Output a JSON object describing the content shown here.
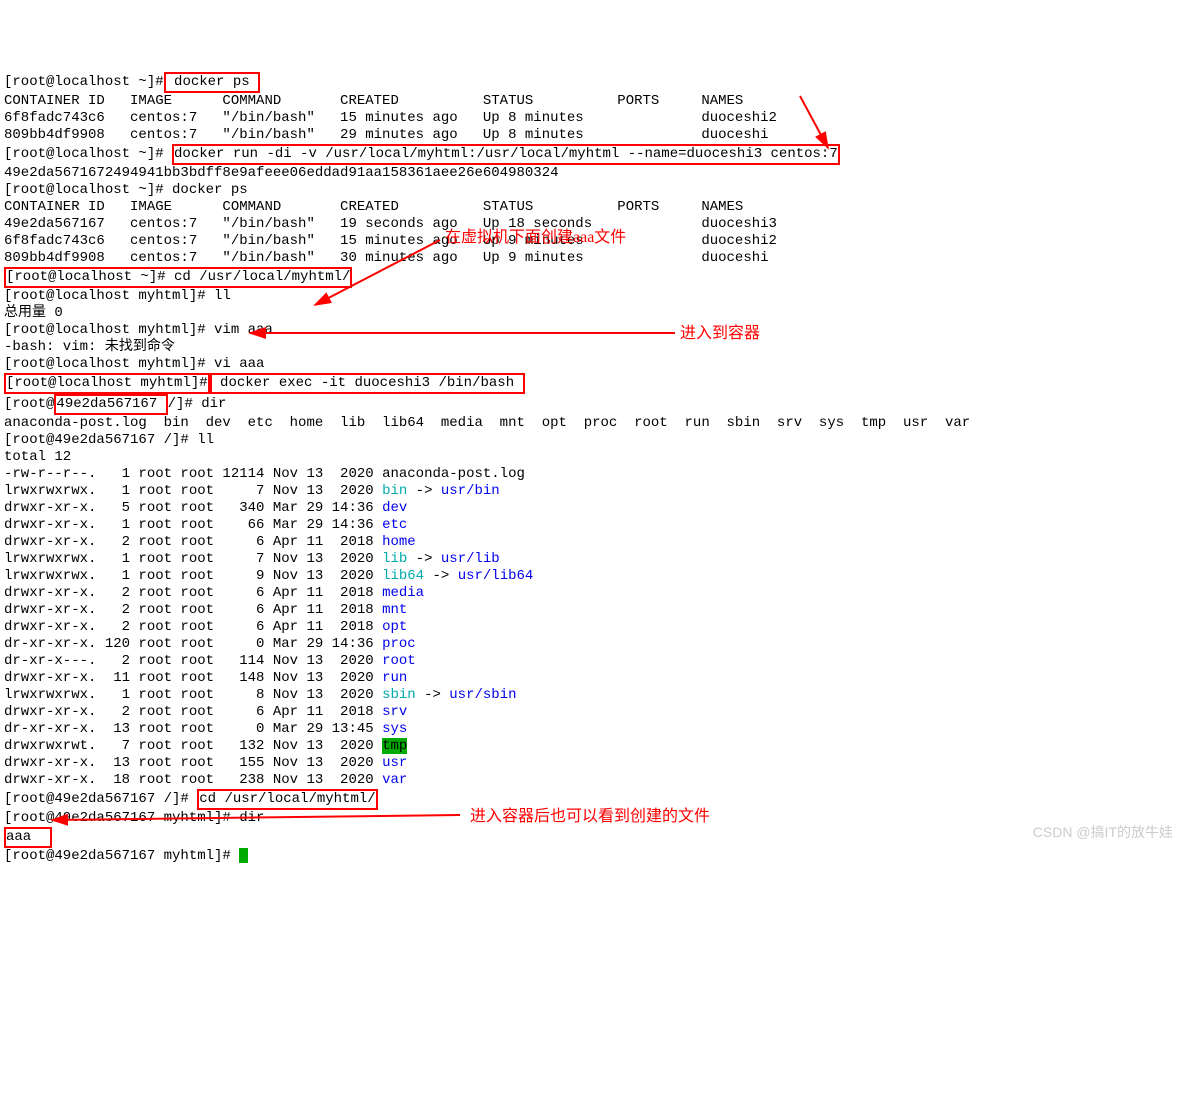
{
  "line1_prompt": "[root@localhost ~]#",
  "line1_cmd": " docker ps ",
  "docker_ps_header": "CONTAINER ID   IMAGE      COMMAND       CREATED          STATUS          PORTS     NAMES",
  "ps1_rows": [
    "6f8fadc743c6   centos:7   \"/bin/bash\"   15 minutes ago   Up 8 minutes              duoceshi2",
    "809bb4df9908   centos:7   \"/bin/bash\"   29 minutes ago   Up 8 minutes              duoceshi"
  ],
  "line_run_prompt": "[root@localhost ~]# ",
  "line_run_cmd": "docker run -di -v /usr/local/myhtml:/usr/local/myhtml --name=duoceshi3 centos:7",
  "run_hash": "49e2da5671672494941bb3bdff8e9afeee06eddad91aa158361aee26e604980324",
  "line_ps2": "[root@localhost ~]# docker ps",
  "ps2_rows": [
    "49e2da567167   centos:7   \"/bin/bash\"   19 seconds ago   Up 18 seconds             duoceshi3",
    "6f8fadc743c6   centos:7   \"/bin/bash\"   15 minutes ago   Up 9 minutes              duoceshi2",
    "809bb4df9908   centos:7   \"/bin/bash\"   30 minutes ago   Up 9 minutes              duoceshi"
  ],
  "cd_line": "[root@localhost ~]# cd /usr/local/myhtml/",
  "ll_line": "[root@localhost myhtml]# ll",
  "total_cn": "总用量 0",
  "vim_line": "[root@localhost myhtml]# vim aaa",
  "vim_err": "-bash: vim: 未找到命令",
  "vi_line": "[root@localhost myhtml]# vi aaa",
  "exec_prompt": "[root@localhost myhtml]#",
  "exec_cmd": " docker exec -it duoceshi3 /bin/bash ",
  "dir_line_prefix": "[root@",
  "dir_hash": "49e2da567167 ",
  "dir_suffix": "/]# dir",
  "dir_output": "anaconda-post.log  bin  dev  etc  home  lib  lib64  media  mnt  opt  proc  root  run  sbin  srv  sys  tmp  usr  var",
  "ll2_line": "[root@49e2da567167 /]# ll",
  "total12": "total 12",
  "ls_rows": [
    {
      "perm": "-rw-r--r--.",
      "n": "  1",
      "own": "root root",
      "size": "12114",
      "date": "Nov 13  2020",
      "name": "anaconda-post.log",
      "color": ""
    },
    {
      "perm": "lrwxrwxrwx.",
      "n": "  1",
      "own": "root root",
      "size": "    7",
      "date": "Nov 13  2020",
      "name": "bin",
      "color": "cyan",
      "extra": " -> ",
      "target": "usr/bin",
      "tcolor": "blue"
    },
    {
      "perm": "drwxr-xr-x.",
      "n": "  5",
      "own": "root root",
      "size": "  340",
      "date": "Mar 29 14:36",
      "name": "dev",
      "color": "blue"
    },
    {
      "perm": "drwxr-xr-x.",
      "n": "  1",
      "own": "root root",
      "size": "   66",
      "date": "Mar 29 14:36",
      "name": "etc",
      "color": "blue"
    },
    {
      "perm": "drwxr-xr-x.",
      "n": "  2",
      "own": "root root",
      "size": "    6",
      "date": "Apr 11  2018",
      "name": "home",
      "color": "blue"
    },
    {
      "perm": "lrwxrwxrwx.",
      "n": "  1",
      "own": "root root",
      "size": "    7",
      "date": "Nov 13  2020",
      "name": "lib",
      "color": "cyan",
      "extra": " -> ",
      "target": "usr/lib",
      "tcolor": "blue"
    },
    {
      "perm": "lrwxrwxrwx.",
      "n": "  1",
      "own": "root root",
      "size": "    9",
      "date": "Nov 13  2020",
      "name": "lib64",
      "color": "cyan",
      "extra": " -> ",
      "target": "usr/lib64",
      "tcolor": "blue"
    },
    {
      "perm": "drwxr-xr-x.",
      "n": "  2",
      "own": "root root",
      "size": "    6",
      "date": "Apr 11  2018",
      "name": "media",
      "color": "blue"
    },
    {
      "perm": "drwxr-xr-x.",
      "n": "  2",
      "own": "root root",
      "size": "    6",
      "date": "Apr 11  2018",
      "name": "mnt",
      "color": "blue"
    },
    {
      "perm": "drwxr-xr-x.",
      "n": "  2",
      "own": "root root",
      "size": "    6",
      "date": "Apr 11  2018",
      "name": "opt",
      "color": "blue"
    },
    {
      "perm": "dr-xr-xr-x.",
      "n": "120",
      "own": "root root",
      "size": "    0",
      "date": "Mar 29 14:36",
      "name": "proc",
      "color": "blue"
    },
    {
      "perm": "dr-xr-x---.",
      "n": "  2",
      "own": "root root",
      "size": "  114",
      "date": "Nov 13  2020",
      "name": "root",
      "color": "blue"
    },
    {
      "perm": "drwxr-xr-x.",
      "n": " 11",
      "own": "root root",
      "size": "  148",
      "date": "Nov 13  2020",
      "name": "run",
      "color": "blue"
    },
    {
      "perm": "lrwxrwxrwx.",
      "n": "  1",
      "own": "root root",
      "size": "    8",
      "date": "Nov 13  2020",
      "name": "sbin",
      "color": "cyan",
      "extra": " -> ",
      "target": "usr/sbin",
      "tcolor": "blue"
    },
    {
      "perm": "drwxr-xr-x.",
      "n": "  2",
      "own": "root root",
      "size": "    6",
      "date": "Apr 11  2018",
      "name": "srv",
      "color": "blue"
    },
    {
      "perm": "dr-xr-xr-x.",
      "n": " 13",
      "own": "root root",
      "size": "    0",
      "date": "Mar 29 13:45",
      "name": "sys",
      "color": "blue"
    },
    {
      "perm": "drwxrwxrwt.",
      "n": "  7",
      "own": "root root",
      "size": "  132",
      "date": "Nov 13  2020",
      "name": "tmp",
      "color": "green-bg"
    },
    {
      "perm": "drwxr-xr-x.",
      "n": " 13",
      "own": "root root",
      "size": "  155",
      "date": "Nov 13  2020",
      "name": "usr",
      "color": "blue"
    },
    {
      "perm": "drwxr-xr-x.",
      "n": " 18",
      "own": "root root",
      "size": "  238",
      "date": "Nov 13  2020",
      "name": "var",
      "color": "blue"
    }
  ],
  "cd2_prompt": "[root@49e2da567167 /]# ",
  "cd2_cmd": "cd /usr/local/myhtml/",
  "dir2_line": "[root@49e2da567167 myhtml]# dir",
  "aaa": "aaa",
  "final_prompt": "[root@49e2da567167 myhtml]# ",
  "annot1": "在虚拟机下面创建aaa文件",
  "annot2": "进入到容器",
  "annot3": "进入容器后也可以看到创建的文件",
  "watermark": "CSDN @搞IT的放牛娃"
}
